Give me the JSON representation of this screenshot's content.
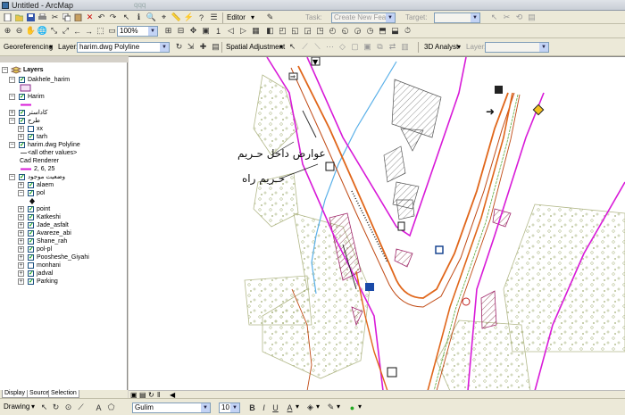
{
  "window": {
    "title": "Untitled - ArcMap",
    "ghost_text": "qqq"
  },
  "editor": {
    "label": "Editor",
    "task_label": "Task:",
    "task_value": "Create New Feature",
    "target_label": "Target:",
    "target_value": ""
  },
  "standard": {
    "zoom_value": "100%"
  },
  "georef": {
    "label": "Georeferencing",
    "layer_label": "Layer:",
    "layer_value": "harim.dwg Polyline"
  },
  "spatial_adjustment": {
    "label": "Spatial Adjustment"
  },
  "analyst": {
    "label": "3D Analyst",
    "layer_label": "Layer:",
    "layer_value": ""
  },
  "toc": {
    "root": "Layers",
    "items": [
      {
        "level": 1,
        "label": "Dakhele_harim",
        "checked": true,
        "expander": "-"
      },
      {
        "level": 2,
        "label": "",
        "swatch": "purple-box"
      },
      {
        "level": 1,
        "label": "Harim",
        "checked": true,
        "expander": "-"
      },
      {
        "level": 2,
        "label": "",
        "swatch": "magenta-line"
      },
      {
        "level": 1,
        "label": "کاداستر",
        "checked": true,
        "expander": "+"
      },
      {
        "level": 1,
        "label": "طرح",
        "checked": true,
        "expander": "-"
      },
      {
        "level": 2,
        "label": "xx",
        "checked": false,
        "expander": "+"
      },
      {
        "level": 2,
        "label": "tarh",
        "checked": true,
        "expander": "+"
      },
      {
        "level": 1,
        "label": "harim.dwg Polyline",
        "checked": true,
        "expander": "-"
      },
      {
        "level": 2,
        "label": "<all other values>",
        "swatch": "gray-line"
      },
      {
        "level": 2,
        "label": "Cad Renderer",
        "swatch": "none"
      },
      {
        "level": 2,
        "label": "2, 6, 25",
        "swatch": "magenta-line"
      },
      {
        "level": 1,
        "label": "وضعیت موجود",
        "checked": true,
        "expander": "-"
      },
      {
        "level": 2,
        "label": "alaem",
        "checked": true,
        "expander": "+"
      },
      {
        "level": 2,
        "label": "pol",
        "checked": true,
        "expander": "-"
      },
      {
        "level": 3,
        "label": "",
        "swatch": "diamond"
      },
      {
        "level": 2,
        "label": "point",
        "checked": true,
        "expander": "+"
      },
      {
        "level": 2,
        "label": "Katkeshi",
        "checked": true,
        "expander": "+"
      },
      {
        "level": 2,
        "label": "Jade_asfalt",
        "checked": true,
        "expander": "+"
      },
      {
        "level": 2,
        "label": "Avareze_abi",
        "checked": true,
        "expander": "+"
      },
      {
        "level": 2,
        "label": "Shane_rah",
        "checked": true,
        "expander": "+"
      },
      {
        "level": 2,
        "label": "pol-pl",
        "checked": true,
        "expander": "+"
      },
      {
        "level": 2,
        "label": "Poosheshe_Giyahi",
        "checked": true,
        "expander": "+"
      },
      {
        "level": 2,
        "label": "monhani",
        "checked": false,
        "expander": "+"
      },
      {
        "level": 2,
        "label": "jadval",
        "checked": true,
        "expander": "+"
      },
      {
        "level": 2,
        "label": "Parking",
        "checked": true,
        "expander": "+"
      }
    ],
    "tabs": [
      "Display",
      "Source",
      "Selection"
    ]
  },
  "map": {
    "annotation_1": "عوارض داخل حـریم",
    "annotation_2": "حـریم راه"
  },
  "drawing": {
    "label": "Drawing",
    "font_value": "Gulim",
    "size_value": "10",
    "bold": "B",
    "italic": "I",
    "underline": "U",
    "text_tool": "A"
  },
  "colors": {
    "harim": "#d81ad8",
    "road": "#e0661a",
    "water": "#5ab0e8",
    "veg": "#9aa86a"
  }
}
